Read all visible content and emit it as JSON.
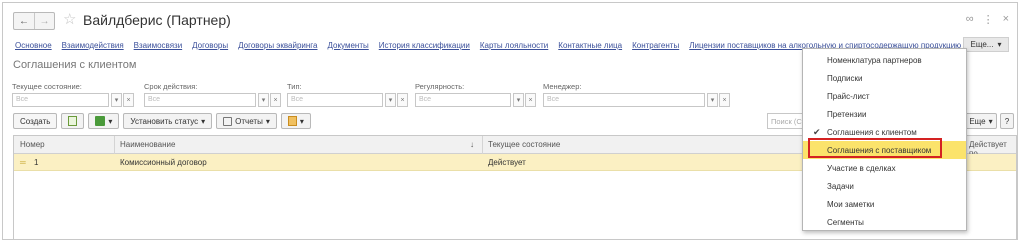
{
  "window": {
    "title": "Вайлдберис (Партнер)",
    "back": "←",
    "forward": "→",
    "star": "☆",
    "link_icon": "🔗",
    "menu_icon": "⋮",
    "close_icon": "×"
  },
  "nav_links": [
    "Основное",
    "Взаимодействия",
    "Взаимосвязи",
    "Договоры",
    "Договоры эквайринга",
    "Документы",
    "История классификации",
    "Карты лояльности",
    "Контактные лица",
    "Контрагенты",
    "Лицензии поставщиков на алкогольную и спиртосодержащую продукцию"
  ],
  "nav_more": "Еще...",
  "dropdown_arrow": "▾",
  "section_title": "Соглашения с клиентом",
  "filters": [
    {
      "label": "Текущее состояние:",
      "placeholder": "Все"
    },
    {
      "label": "Срок действия:",
      "placeholder": "Все"
    },
    {
      "label": "Тип:",
      "placeholder": "Все"
    },
    {
      "label": "Регулярность:",
      "placeholder": "Все"
    },
    {
      "label": "Менеджер:",
      "placeholder": "Все"
    }
  ],
  "filter_buttons": {
    "dropdown": "▾",
    "clear": "×"
  },
  "toolbar": {
    "create": "Создать",
    "set_status": "Установить статус",
    "reports": "Отчеты",
    "dropdown": "▾"
  },
  "search": {
    "placeholder": "Поиск (Ctrl+F)"
  },
  "more_right": "Еще",
  "help": "?",
  "table": {
    "columns": [
      "Номер",
      "Наименование",
      "Текущее состояние",
      "Действует по"
    ],
    "sort_icon": "↓",
    "rows": [
      {
        "marker": "═",
        "number": "1",
        "name": "Комиссионный договор",
        "state": "Действует"
      }
    ]
  },
  "menu": {
    "items": [
      {
        "label": "Номенклатура партнеров",
        "checked": false,
        "selected": false
      },
      {
        "label": "Подписки",
        "checked": false,
        "selected": false
      },
      {
        "label": "Прайс-лист",
        "checked": false,
        "selected": false
      },
      {
        "label": "Претензии",
        "checked": false,
        "selected": false
      },
      {
        "label": "Соглашения с клиентом",
        "checked": true,
        "selected": false
      },
      {
        "label": "Соглашения с поставщиком",
        "checked": false,
        "selected": true
      },
      {
        "label": "Участие в сделках",
        "checked": false,
        "selected": false
      },
      {
        "label": "Задачи",
        "checked": false,
        "selected": false
      },
      {
        "label": "Мои заметки",
        "checked": false,
        "selected": false
      },
      {
        "label": "Сегменты",
        "checked": false,
        "selected": false
      }
    ],
    "check_mark": "✔"
  },
  "colors": {
    "link": "#3a4f9a",
    "row_highlight": "#fbf0c3",
    "menu_selected": "#fbe36b",
    "highlight_box": "#d42222"
  }
}
